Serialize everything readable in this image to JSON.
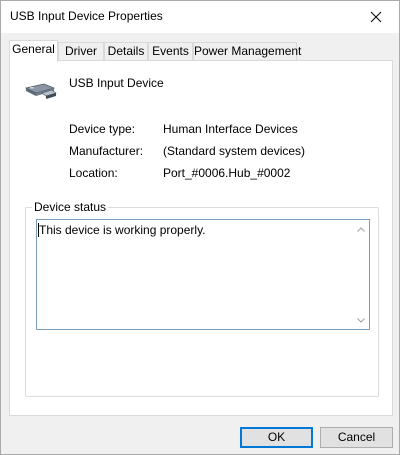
{
  "window": {
    "title": "USB Input Device Properties"
  },
  "tabs": [
    {
      "label": "General"
    },
    {
      "label": "Driver"
    },
    {
      "label": "Details"
    },
    {
      "label": "Events"
    },
    {
      "label": "Power Management"
    }
  ],
  "general": {
    "device_name": "USB Input Device",
    "device_type_label": "Device type:",
    "device_type_value": "Human Interface Devices",
    "manufacturer_label": "Manufacturer:",
    "manufacturer_value": "(Standard system devices)",
    "location_label": "Location:",
    "location_value": "Port_#0006.Hub_#0002",
    "status_group_label": "Device status",
    "status_text": "This device is working properly."
  },
  "buttons": {
    "ok": "OK",
    "cancel": "Cancel"
  },
  "icons": {
    "close": "close-icon",
    "device": "usb-device-icon"
  },
  "colors": {
    "focus_border": "#0078d7",
    "status_border": "#7a9cbf"
  }
}
